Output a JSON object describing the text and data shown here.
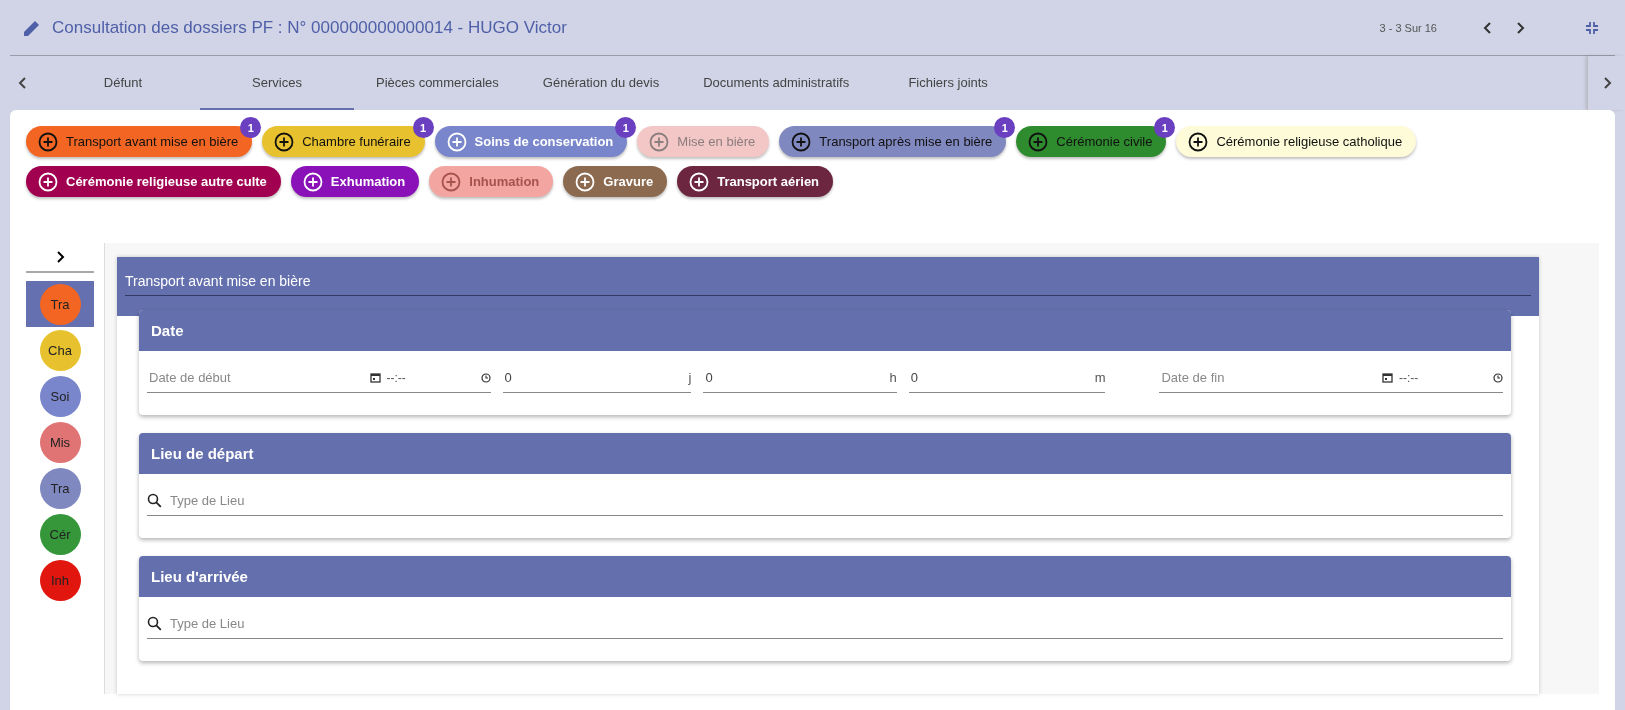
{
  "header": {
    "title": "Consultation des dossiers PF : N° 000000000000014 - HUGO Victor",
    "pager": "3 - 3 Sur 16"
  },
  "tabs": [
    {
      "label": "Défunt",
      "selected": false
    },
    {
      "label": "Services",
      "selected": true
    },
    {
      "label": "Pièces commerciales",
      "selected": false
    },
    {
      "label": "Génération du devis",
      "selected": false
    },
    {
      "label": "Documents administratifs",
      "selected": false
    },
    {
      "label": "Fichiers joints",
      "selected": false
    }
  ],
  "services": [
    {
      "label": "Transport avant mise en bière",
      "color": "#f26522",
      "kind": "light",
      "disabled": false,
      "badge": "1"
    },
    {
      "label": "Chambre funéraire",
      "color": "#e8c22e",
      "kind": "light",
      "disabled": false,
      "badge": "1"
    },
    {
      "label": "Soins de conservation",
      "color": "#7986cb",
      "kind": "dark",
      "disabled": false,
      "badge": "1"
    },
    {
      "label": "Mise en bière",
      "color": "#f4c7c7",
      "kind": "light",
      "disabled": true
    },
    {
      "label": "Transport après mise en bière",
      "color": "#8088c0",
      "kind": "light",
      "disabled": false,
      "badge": "1"
    },
    {
      "label": "Cérémonie civile",
      "color": "#2e8b2e",
      "kind": "light",
      "disabled": false,
      "badge": "1"
    },
    {
      "label": "Cérémonie religieuse catholique",
      "color": "#fdfbd8",
      "kind": "light",
      "disabled": false
    },
    {
      "label": "Cérémonie religieuse autre culte",
      "color": "#a0004f",
      "kind": "dark",
      "disabled": false
    },
    {
      "label": "Exhumation",
      "color": "#8a10b8",
      "kind": "dark",
      "disabled": false
    },
    {
      "label": "Inhumation",
      "color": "#f2a5a1",
      "kind": "dark",
      "disabled": true
    },
    {
      "label": "Gravure",
      "color": "#8b6a4f",
      "kind": "dark",
      "disabled": false
    },
    {
      "label": "Transport aérien",
      "color": "#6d2640",
      "kind": "dark",
      "disabled": false
    }
  ],
  "sidebar": {
    "items": [
      {
        "label": "Tra",
        "color": "#f26522",
        "selected": true
      },
      {
        "label": "Cha",
        "color": "#e8c22e",
        "selected": false
      },
      {
        "label": "Soi",
        "color": "#7986cb",
        "selected": false
      },
      {
        "label": "Mis",
        "color": "#e07373",
        "selected": false
      },
      {
        "label": "Tra",
        "color": "#8088c0",
        "selected": false
      },
      {
        "label": "Cér",
        "color": "#35963a",
        "selected": false
      },
      {
        "label": "Inh",
        "color": "#e0160f",
        "selected": false
      }
    ]
  },
  "section": {
    "title": "Transport avant mise en bière",
    "cards": [
      {
        "title": "Date",
        "kind": "date",
        "fields": [
          {
            "kind": "datetime",
            "placeholder": "Date de début",
            "time": "--:--"
          },
          {
            "kind": "number",
            "value": "0",
            "unit": "j"
          },
          {
            "kind": "number",
            "value": "0",
            "unit": "h"
          },
          {
            "kind": "number",
            "value": "0",
            "unit": "m"
          },
          {
            "kind": "datetime",
            "placeholder": "Date de fin",
            "time": "--:--"
          }
        ]
      },
      {
        "title": "Lieu de départ",
        "kind": "search",
        "placeholder": "Type de Lieu"
      },
      {
        "title": "Lieu d'arrivée",
        "kind": "search",
        "placeholder": "Type de Lieu"
      }
    ]
  }
}
